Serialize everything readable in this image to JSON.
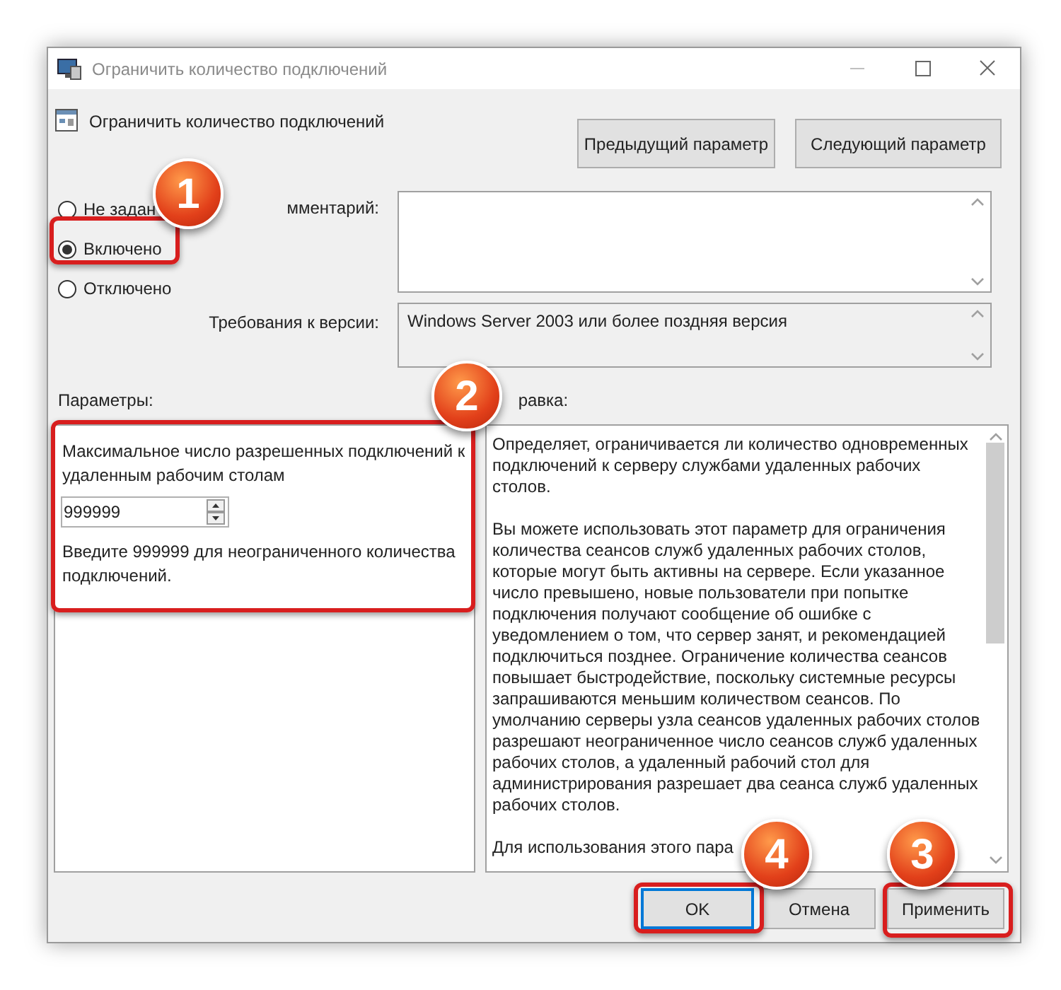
{
  "window": {
    "title": "Ограничить количество подключений"
  },
  "policy": {
    "name": "Ограничить количество подключений"
  },
  "nav_buttons": [
    "Предыдущий параметр",
    "Следующий параметр"
  ],
  "state_options": [
    {
      "label": "Не задан",
      "selected": false
    },
    {
      "label": "Включено",
      "selected": true
    },
    {
      "label": "Отключено",
      "selected": false
    }
  ],
  "comment": {
    "label": "мментарий:"
  },
  "requirements": {
    "label": "Требования к версии:",
    "value": "Windows Server 2003 или более поздняя версия"
  },
  "options_panel": {
    "label": "Параметры:",
    "field_label": "Максимальное число разрешенных подключений к удаленным рабочим столам",
    "value": "999999",
    "hint": "Введите 999999 для неограниченного количества подключений."
  },
  "help_panel": {
    "label": "равка:",
    "paragraphs": [
      "Определяет, ограничивается ли количество одновременных подключений к серверу службами удаленных рабочих столов.",
      "Вы можете использовать этот параметр для ограничения количества сеансов служб удаленных рабочих столов, которые могут быть активны на сервере. Если указанное число превышено, новые пользователи при попытке подключения получают сообщение об ошибке с уведомлением о том, что сервер занят, и рекомендацией подключиться позднее. Ограничение количества сеансов повышает быстродействие, поскольку системные ресурсы запрашиваются меньшим количеством сеансов. По умолчанию серверы узла сеансов удаленных рабочих столов разрешают неограниченное число сеансов служб удаленных рабочих столов, а удаленный рабочий стол для администрирования разрешает два сеанса служб удаленных рабочих столов.",
      "Для использования этого пара"
    ]
  },
  "dialog_buttons": [
    {
      "label": "OK",
      "focused": true
    },
    {
      "label": "Отмена",
      "focused": false
    },
    {
      "label": "Применить",
      "focused": false
    }
  ],
  "callouts": [
    "1",
    "2",
    "4",
    "3"
  ]
}
